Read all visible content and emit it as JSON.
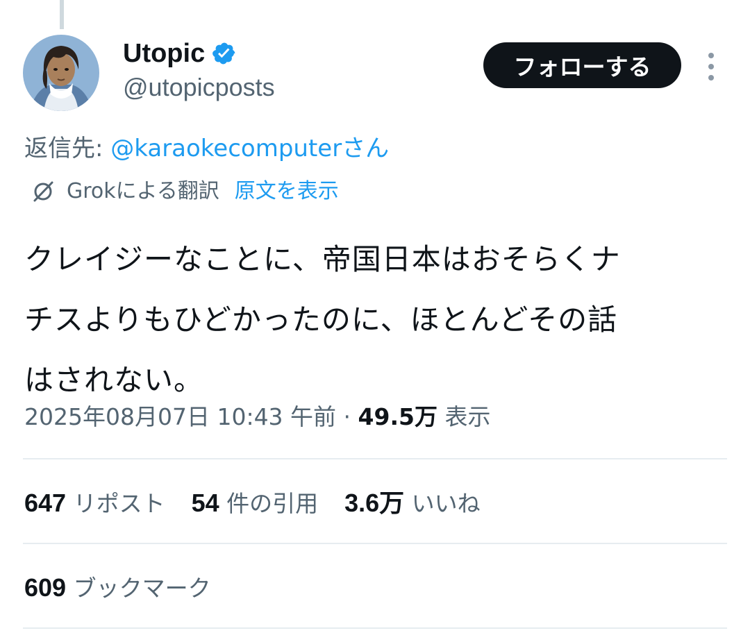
{
  "author": {
    "display_name": "Utopic",
    "handle": "@utopicposts",
    "verified_icon": "verified-badge-icon"
  },
  "follow_button_label": "フォローする",
  "reply_to": {
    "prefix": "返信先: ",
    "mention": "@karaokecomputer",
    "suffix": "さん"
  },
  "translation": {
    "icon": "grok-icon",
    "label": "Grokによる翻訳",
    "show_original": "原文を表示"
  },
  "tweet_text_lines": [
    "クレイジーなことに、帝国日本はおそらくナ",
    "チスよりもひどかったのに、ほとんどその話",
    "はされない。"
  ],
  "meta": {
    "timestamp": "2025年08月07日 10:43 午前",
    "separator": " · ",
    "views_count": "49.5万",
    "views_label": " 表示"
  },
  "stats": {
    "reposts": {
      "count": "647",
      "label": "リポスト"
    },
    "quotes": {
      "count": "54",
      "label": "件の引用"
    },
    "likes": {
      "count": "3.6万",
      "label": "いいね"
    },
    "bookmarks": {
      "count": "609",
      "label": "ブックマーク"
    }
  },
  "colors": {
    "link": "#1d9bf0",
    "secondary_text": "#536471",
    "primary_text": "#0f1419",
    "divider": "#e6ecf0"
  }
}
